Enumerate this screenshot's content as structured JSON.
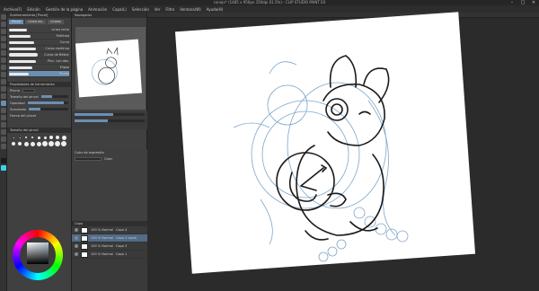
{
  "app": {
    "title": "conejo* (1485 x 950px 350dpi 61.5%) - CLIP STUDIO PAINT EX"
  },
  "menu": [
    "Archivo(F)",
    "Edición",
    "Gestión de la página",
    "Animación",
    "Capa(L)",
    "Selección",
    "Ver",
    "Filtro",
    "Ventana(W)",
    "Ayuda(H)"
  ],
  "left_panel": {
    "tabs": [
      "Subherramienta [Pincel]"
    ],
    "brush_tabs": [
      "Pincel",
      "Línea rec.",
      "Líneas"
    ],
    "brushes": [
      {
        "label": "Línea recta"
      },
      {
        "label": "Polilínea"
      },
      {
        "label": "Curva"
      },
      {
        "label": "Curva continua"
      },
      {
        "label": "Curva de Bézier"
      },
      {
        "label": "Pinc. con des."
      },
      {
        "label": "Elipse"
      },
      {
        "label": "Pluma"
      }
    ],
    "properties_title": "Propiedades de herramienta",
    "properties": [
      {
        "label": "Pluma"
      },
      {
        "label": "Tamaño del pincel"
      },
      {
        "label": "Opacidad"
      },
      {
        "label": "Suavizado"
      },
      {
        "label": "Forma del pincel"
      }
    ],
    "brush_size_title": "Tamaño del pincel"
  },
  "mid_panel": {
    "navigator_title": "Navegador",
    "layer_title": "Capa",
    "layers": [
      {
        "name": "100 % Normal",
        "sub": "Capa 4"
      },
      {
        "name": "100 % Normal",
        "sub": "Capa 2 copia"
      },
      {
        "name": "100 % Normal",
        "sub": "Capa 3"
      },
      {
        "name": "100 % Normal",
        "sub": "Capa 1"
      }
    ],
    "color_label": "Color de expresión",
    "color_value": "Color"
  },
  "colors": {
    "accent": "#6a8fb0",
    "panel": "#404040",
    "canvas_bg": "#2b2b2b",
    "sketch_blue": "#7fa6c9",
    "line_black": "#1a1a1a"
  }
}
